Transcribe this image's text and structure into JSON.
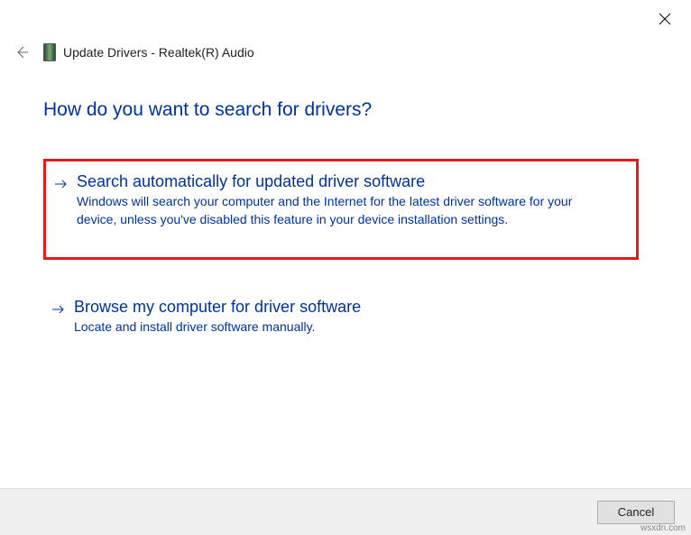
{
  "header": {
    "title": "Update Drivers - Realtek(R) Audio"
  },
  "heading": "How do you want to search for drivers?",
  "options": {
    "auto": {
      "title": "Search automatically for updated driver software",
      "desc": "Windows will search your computer and the Internet for the latest driver software for your device, unless you've disabled this feature in your device installation settings."
    },
    "browse": {
      "title": "Browse my computer for driver software",
      "desc": "Locate and install driver software manually."
    }
  },
  "footer": {
    "cancel": "Cancel"
  },
  "watermark": "wsxdn.com"
}
